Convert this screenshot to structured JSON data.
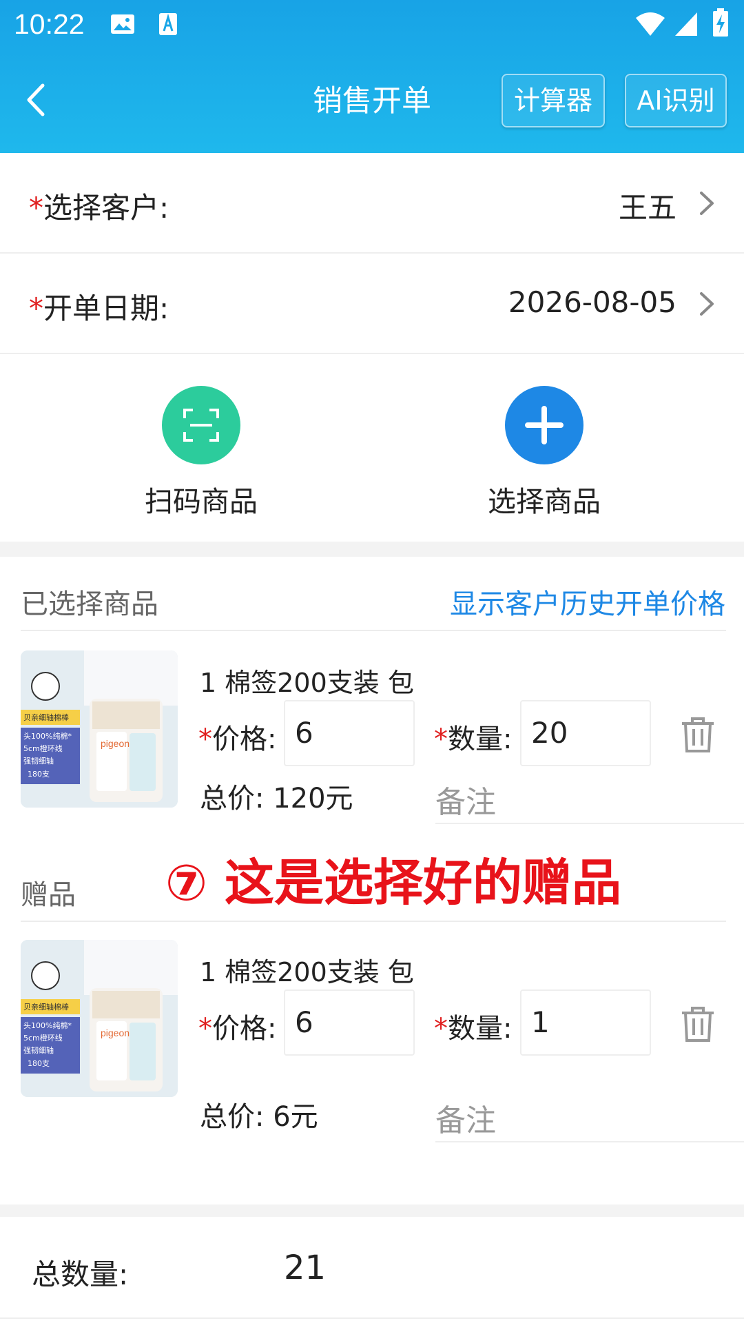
{
  "status_bar": {
    "time": "10:22",
    "icons": [
      "image-icon",
      "a-letter-icon",
      "wifi-icon",
      "signal-icon",
      "battery-charging-icon"
    ]
  },
  "nav": {
    "title": "销售开单",
    "back_icon": "chevron-left-icon",
    "calculator_label": "计算器",
    "ai_label": "AI识别"
  },
  "form": {
    "required_mark": "*",
    "customer": {
      "label": "选择客户:",
      "value": "王五"
    },
    "date": {
      "label": "开单日期:",
      "value": "2026-08-05"
    }
  },
  "actions": {
    "scan_label": "扫码商品",
    "select_label": "选择商品"
  },
  "selected": {
    "title": "已选择商品",
    "history_link": "显示客户历史开单价格",
    "items": [
      {
        "name": "1 棉签200支装 包",
        "price_label": "价格:",
        "price": "6",
        "qty_label": "数量:",
        "qty": "20",
        "total": "总价: 120元",
        "remark_placeholder": "备注"
      }
    ]
  },
  "annotation": "⑦ 这是选择好的赠品",
  "gifts": {
    "title": "赠品",
    "items": [
      {
        "name": "1 棉签200支装 包",
        "price_label": "价格:",
        "price": "6",
        "qty_label": "数量:",
        "qty": "1",
        "total": "总价: 6元",
        "remark_placeholder": "备注"
      }
    ]
  },
  "summary": {
    "total_qty_label": "总数量:",
    "total_qty": "21"
  },
  "colors": {
    "header": "#1aa8e8",
    "accent_blue": "#1e88e5",
    "scan_green": "#2ccc9c",
    "required_red": "#e02020",
    "annotation_red": "#e8131a"
  },
  "product_thumb_text": {
    "brand": "pigeon",
    "lines": [
      "贝亲细轴棉棒",
      "头100%纯棉*",
      "5cm橙环线",
      "强韧细轴",
      "180支"
    ]
  }
}
